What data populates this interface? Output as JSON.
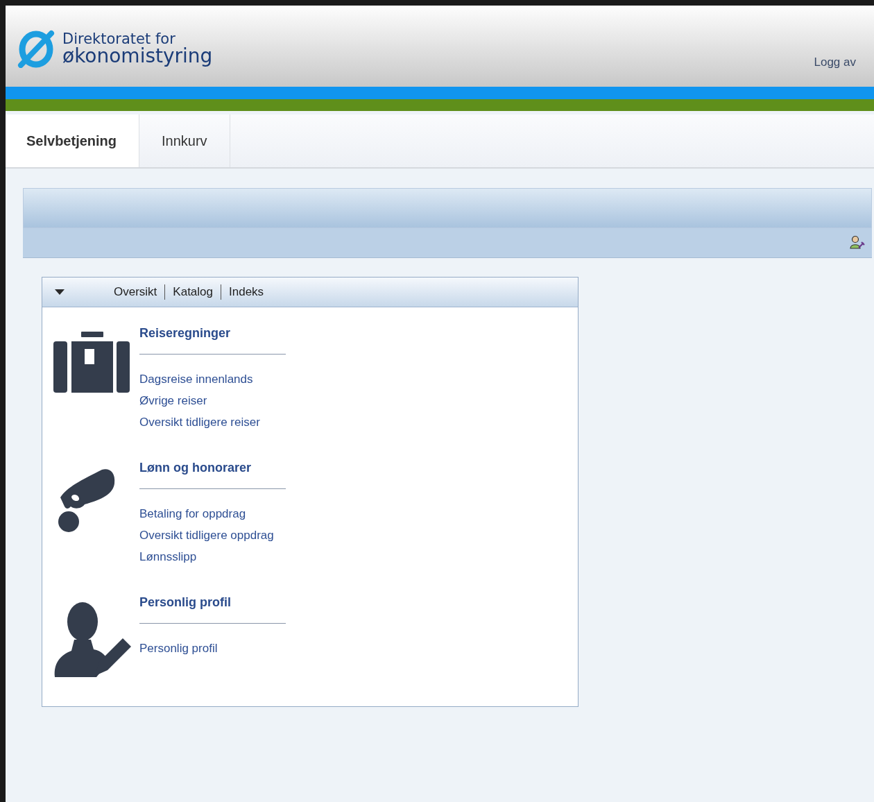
{
  "header": {
    "logo_line_1": "Direktoratet for",
    "logo_line_2": "økonomistyring",
    "logout": "Logg av"
  },
  "tabs": [
    {
      "label": "Selvbetjening",
      "selected": true
    },
    {
      "label": "Innkurv",
      "selected": false
    }
  ],
  "portlet": {
    "menu": [
      "Oversikt",
      "Katalog",
      "Indeks"
    ],
    "sections": [
      {
        "kind": "suitcase",
        "title": "Reiseregninger",
        "links": [
          "Dagsreise innenlands",
          "Øvrige reiser",
          "Oversikt tidligere reiser"
        ]
      },
      {
        "kind": "hand",
        "title": "Lønn og honorarer",
        "links": [
          "Betaling for oppdrag",
          "Oversikt tidligere oppdrag",
          "Lønnsslipp"
        ]
      },
      {
        "kind": "person",
        "title": "Personlig profil",
        "links": [
          "Personlig profil"
        ]
      }
    ]
  }
}
